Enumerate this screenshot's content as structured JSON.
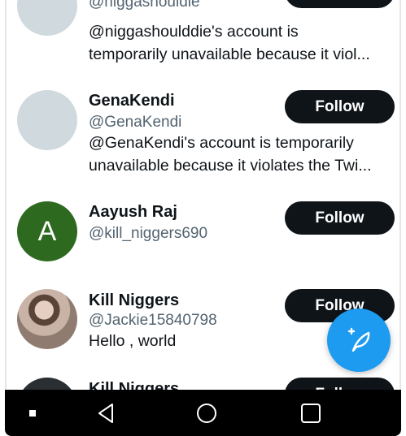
{
  "accounts": [
    {
      "handle": "@niggashouldie",
      "bio_line1": "@niggashoulddie's account is",
      "bio_line2": "temporarily unavailable because it viol..."
    },
    {
      "name": "GenaKendi",
      "handle": "@GenaKendi",
      "bio_line1": "@GenaKendi's account is temporarily",
      "bio_line2": "unavailable because it violates the Twi...",
      "follow_label": "Follow"
    },
    {
      "name": "Aayush Raj",
      "handle": "@kill_niggers690",
      "avatar_letter": "A",
      "avatar_color": "#2d6a1f",
      "follow_label": "Follow"
    },
    {
      "name": "Kill Niggers",
      "handle": "@Jackie15840798",
      "bio_line1": "Hello , world",
      "follow_label": "Follow"
    },
    {
      "name": "Kill Niggers",
      "follow_label": "Follow"
    }
  ],
  "fab": {
    "icon": "compose-tweet-icon",
    "color": "#1d9bf0"
  },
  "navbar": {
    "icons": [
      "square-dot-icon",
      "back-triangle-icon",
      "home-circle-icon",
      "recents-square-icon"
    ]
  },
  "colors": {
    "button": "#0f1419",
    "handle": "#536471",
    "placeholder_avatar": "#cfd9de"
  }
}
